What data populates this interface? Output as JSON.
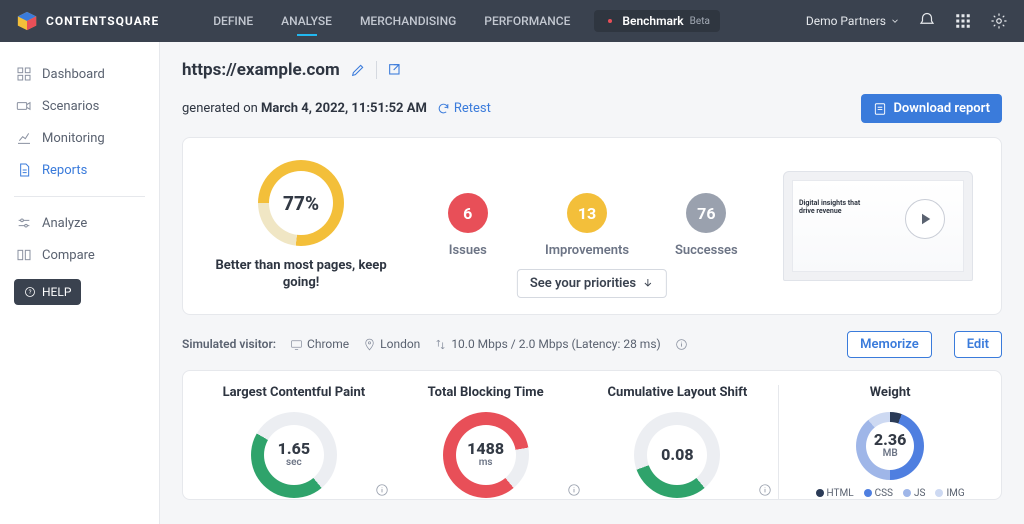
{
  "brand": "CONTENTSQUARE",
  "nav": {
    "define": "DEFINE",
    "analyse": "ANALYSE",
    "merch": "MERCHANDISING",
    "perf": "PERFORMANCE",
    "bench": "Benchmark",
    "beta": "Beta"
  },
  "user": {
    "name": "Demo Partners"
  },
  "sidebar": {
    "dashboard": "Dashboard",
    "scenarios": "Scenarios",
    "monitoring": "Monitoring",
    "reports": "Reports",
    "analyze": "Analyze",
    "compare": "Compare",
    "help": "HELP"
  },
  "page": {
    "url": "https://example.com",
    "generated_prefix": "generated on ",
    "generated_date": "March 4, 2022, 11:51:52 AM",
    "retest": "Retest",
    "download": "Download report"
  },
  "summary": {
    "score": "77%",
    "caption": "Better than most pages, keep going!",
    "issues_n": "6",
    "issues_l": "Issues",
    "improv_n": "13",
    "improv_l": "Improvements",
    "success_n": "76",
    "success_l": "Successes",
    "priorities_btn": "See your priorities",
    "preview_headline": "Digital insights that drive revenue"
  },
  "conditions": {
    "label": "Simulated visitor:",
    "browser": "Chrome",
    "location": "London",
    "network": "10.0 Mbps / 2.0 Mbps (Latency: 28 ms)",
    "memorize": "Memorize",
    "edit": "Edit"
  },
  "metrics": {
    "lcp_title": "Largest Contentful Paint",
    "lcp_val": "1.65",
    "lcp_unit": "sec",
    "tbt_title": "Total Blocking Time",
    "tbt_val": "1488",
    "tbt_unit": "ms",
    "cls_title": "Cumulative Layout Shift",
    "cls_val": "0.08",
    "weight_title": "Weight",
    "weight_val": "2.36",
    "weight_unit": "MB",
    "legend": {
      "html": "HTML",
      "css": "CSS",
      "js": "JS",
      "img": "IMG"
    }
  }
}
